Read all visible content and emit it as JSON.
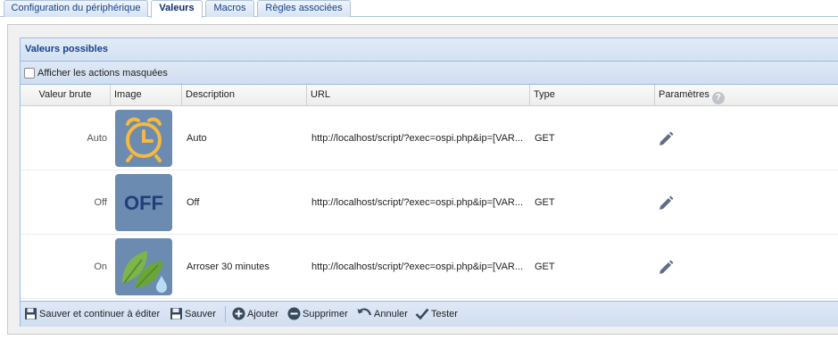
{
  "tabs": [
    {
      "label": "Configuration du périphérique",
      "active": false
    },
    {
      "label": "Valeurs",
      "active": true
    },
    {
      "label": "Macros",
      "active": false
    },
    {
      "label": "Règles associées",
      "active": false
    }
  ],
  "grid": {
    "title": "Valeurs possibles",
    "show_hidden_label": "Afficher les actions masquées",
    "show_hidden_checked": false,
    "columns": {
      "raw": "Valeur brute",
      "image": "Image",
      "description": "Description",
      "url": "URL",
      "type": "Type",
      "params": "Paramètres"
    },
    "rows": [
      {
        "raw": "Auto",
        "image": "alarm-clock-icon",
        "description": "Auto",
        "url": "http://localhost/script/?exec=ospi.php&ip=[VAR...",
        "type": "GET"
      },
      {
        "raw": "Off",
        "image": "off-text-icon",
        "description": "Off",
        "url": "http://localhost/script/?exec=ospi.php&ip=[VAR...",
        "type": "GET"
      },
      {
        "raw": "On",
        "image": "leaf-water-drop-icon",
        "description": "Arroser 30 minutes",
        "url": "http://localhost/script/?exec=ospi.php&ip=[VAR...",
        "type": "GET"
      }
    ],
    "thumb_text_off": "OFF"
  },
  "toolbar": {
    "save_continue": "Sauver et continuer à éditer",
    "save": "Sauver",
    "add": "Ajouter",
    "delete": "Supprimer",
    "cancel": "Annuler",
    "test": "Tester"
  },
  "colors": {
    "accent": "#15428b",
    "thumb_bg": "#6b8bb0",
    "clock": "#f5b942",
    "leaf": "#7db54a"
  }
}
